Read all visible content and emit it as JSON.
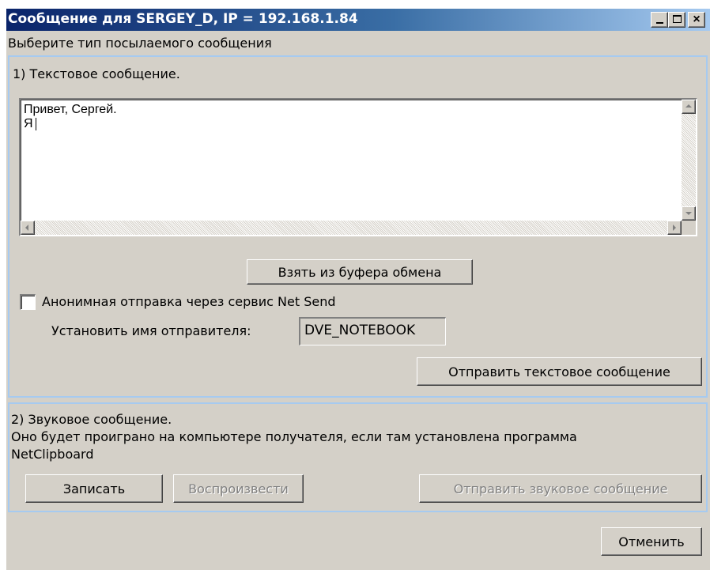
{
  "window": {
    "title": "Сообщение для SERGEY_D, IP = 192.168.1.84",
    "minimize_glyph": "_",
    "close_glyph": "×"
  },
  "prompt": "Выберите тип посылаемого сообщения",
  "text_section": {
    "heading": "1) Текстовое сообщение.",
    "message_value": "Привет, Сергей.\nЯ",
    "clipboard_button": "Взять из буфера обмена",
    "anonymous_checkbox_label": "Анонимная отправка через сервис Net Send",
    "anonymous_checked": false,
    "sender_label": "Установить имя отправителя:",
    "sender_value": "DVE_NOTEBOOK",
    "send_button": "Отправить текстовое сообщение"
  },
  "sound_section": {
    "heading": "2) Звуковое сообщение.",
    "description_line1": "Оно будет проиграно на компьютере получателя, если там установлена программа",
    "description_line2": "NetClipboard",
    "record_button": "Записать",
    "play_button": "Воспроизвести",
    "send_button": "Отправить звуковое сообщение"
  },
  "cancel_button": "Отменить",
  "colors": {
    "titlebar_start": "#0a246a",
    "titlebar_end": "#a6caf0",
    "dialog_face": "#d4d0c8",
    "group_border": "#a6caf0"
  }
}
